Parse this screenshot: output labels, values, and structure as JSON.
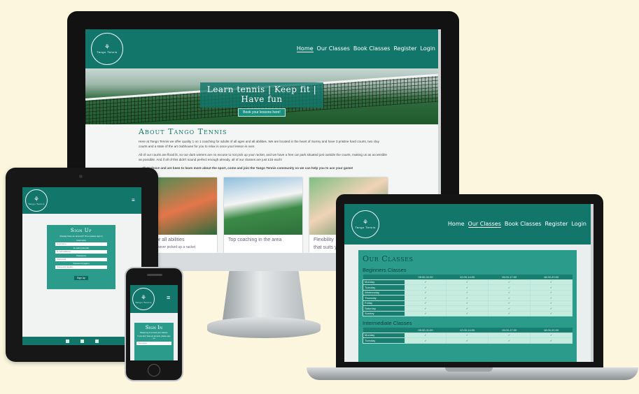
{
  "brand": {
    "name": "Tango Tennis",
    "mark": "⚘"
  },
  "nav": {
    "items": [
      "Home",
      "Our Classes",
      "Book Classes",
      "Register",
      "Login"
    ]
  },
  "desktop": {
    "hero_title": "Learn tennis | Keep fit | Have fun",
    "hero_button": "Book your lessons here!",
    "about_title": "About Tango Tennis",
    "about_p1": "Here at Tango Tennis we offer quality 1 on 1 coaching for adults of all ages and all abilities. We are located in the heart of Surrey and have 3 pristine hard courts, two clay courts and a state of the art clubhouse for you to relax in once your lesson is over.",
    "about_p2": "All of our courts are flood lit, so our dark winters are no excuse to not pick up your racket, and we have a free car park situated just outside the courts, making us as accessible as possible. And if all of this didn't sound perfect enough already, all of our classes are just £15 each!",
    "about_p3": "…all or above and are keen to learn more about the sport, come and join the Tango Tennis community so we can help you to ace your game!",
    "cards": [
      {
        "caption": "…ter for all abilities",
        "sub": "…you've never picked up a racket"
      },
      {
        "caption": "Top coaching in the area",
        "sub": ""
      },
      {
        "caption": "Flexibility",
        "sub": "that suits y…"
      }
    ]
  },
  "tablet": {
    "form_title": "Sign Up",
    "note": "Already have an account? Then please sign in",
    "fields": [
      {
        "label": "Username",
        "placeholder": "Username"
      },
      {
        "label": "E-mail (optional)",
        "placeholder": "E-mail address"
      },
      {
        "label": "Password",
        "placeholder": "Password"
      },
      {
        "label": "Password (again)",
        "placeholder": "Password (again)"
      }
    ],
    "button": "Sign Up"
  },
  "phone": {
    "form_title": "Sign In",
    "note1": "Please log in to book your classes.",
    "note2": "If you don't have an account, please sign up",
    "field": "Username"
  },
  "laptop": {
    "title": "Our Classes",
    "section1": "Beginners Classes",
    "section2": "Intermediate Classes",
    "times": [
      "09:00-11:00",
      "12:00-14:00",
      "15:00-17:00",
      "18:00-20:00"
    ],
    "days": [
      "Monday",
      "Tuesday",
      "Wednesday",
      "Thursday",
      "Friday",
      "Saturday",
      "Sunday"
    ],
    "days2": [
      "Monday",
      "Tuesday"
    ],
    "tick": "✓"
  },
  "colors": {
    "primary": "#13766b",
    "panel": "#2b9c8c",
    "background": "#fbf6dd"
  }
}
